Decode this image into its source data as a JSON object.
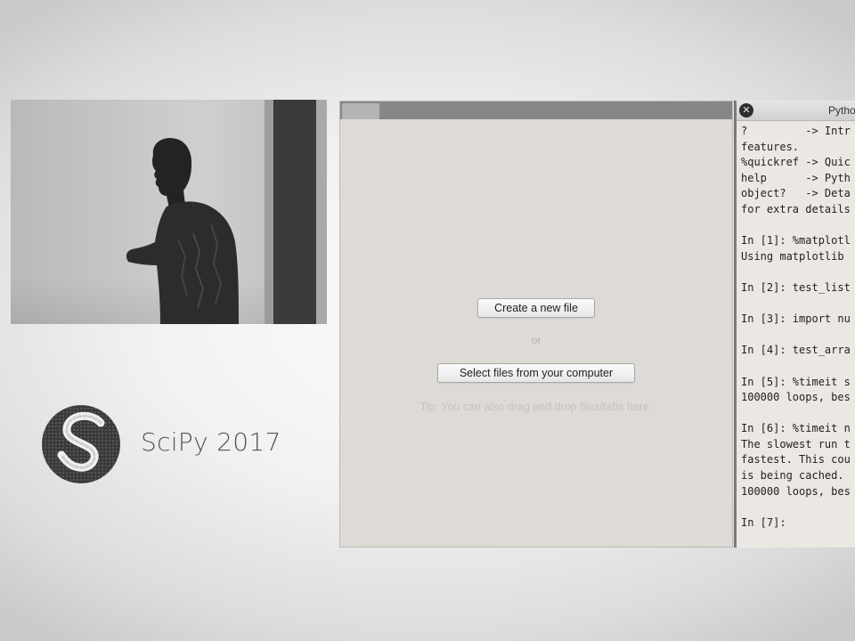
{
  "branding": {
    "event": "SciPy 2017"
  },
  "file_manager": {
    "create_label": "Create a new file",
    "or_label": "or",
    "select_label": "Select files from your computer",
    "tip": "Tip: You can also drag and drop files/tabs here."
  },
  "console": {
    "title": "Pytho",
    "lines": [
      "?         -> Intr",
      "features.",
      "%quickref -> Quic",
      "help      -> Pyth",
      "object?   -> Deta",
      "for extra details",
      "",
      "In [1]: %matplotl",
      "Using matplotlib ",
      "",
      "In [2]: test_list",
      "",
      "In [3]: import nu",
      "",
      "In [4]: test_arra",
      "",
      "In [5]: %timeit s",
      "100000 loops, bes",
      "",
      "In [6]: %timeit n",
      "The slowest run t",
      "fastest. This cou",
      "is being cached. ",
      "100000 loops, bes",
      "",
      "In [7]:"
    ]
  },
  "icons": {
    "close": "close-icon",
    "logo": "scipy-logo"
  },
  "colors": {
    "console_bg": "#ebe7e3",
    "file_panel_bg": "#dedad6",
    "tab_bar": "#878787"
  }
}
